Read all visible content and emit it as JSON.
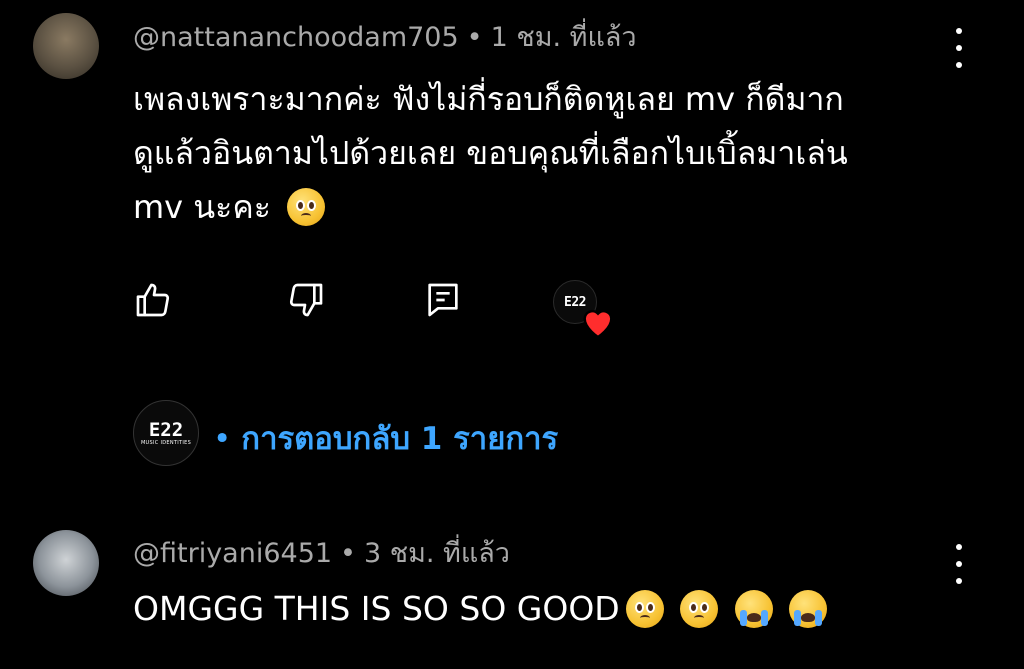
{
  "comments": [
    {
      "handle": "@nattananchoodam705",
      "time": "1 ชม. ที่แล้ว",
      "text_lines": [
        "เพลงเพราะมากค่ะ ฟังไม่กี่รอบก็ติดหูเลย mv ก็ดีมาก",
        "ดูแล้วอินตามไปด้วยเลย ขอบคุณที่เลือกไบเบิ้ลมาเล่น",
        "mv นะคะ"
      ],
      "emoji": [
        "pleading-face"
      ],
      "actions": {
        "like_icon": "thumbs-up-icon",
        "dislike_icon": "thumbs-down-icon",
        "reply_icon": "comment-icon",
        "creator_heart": {
          "logo_text": "E22",
          "color": "#ff2d2d"
        }
      },
      "replies": {
        "logo_text": "E22",
        "logo_subtext": "MUSIC IDENTITIES",
        "label": "การตอบกลับ 1 รายการ",
        "color": "#3ea6ff"
      }
    },
    {
      "handle": "@fitriyani6451",
      "time": "3 ชม. ที่แล้ว",
      "text": "OMGGG THIS IS SO SO GOOD",
      "emoji": [
        "pleading-face",
        "pleading-face",
        "loudly-crying-face",
        "loudly-crying-face"
      ]
    }
  ],
  "separator": "•",
  "menu_icon": "more-vert-icon"
}
